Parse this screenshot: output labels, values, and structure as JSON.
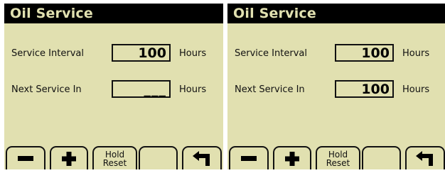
{
  "screens": [
    {
      "title": "Oil Service",
      "service_interval": {
        "label": "Service Interval",
        "value": "100",
        "unit": "Hours"
      },
      "next_service": {
        "label": "Next Service In",
        "value": "___",
        "unit": "Hours"
      },
      "softkeys": {
        "hold_reset": "Hold\nReset"
      }
    },
    {
      "title": "Oil Service",
      "service_interval": {
        "label": "Service Interval",
        "value": "100",
        "unit": "Hours"
      },
      "next_service": {
        "label": "Next Service In",
        "value": "100",
        "unit": "Hours"
      },
      "softkeys": {
        "hold_reset": "Hold\nReset"
      }
    }
  ],
  "icons": [
    "minus-icon",
    "plus-icon",
    "back-arrow-icon"
  ],
  "colors": {
    "background": "#e1e0b0",
    "titlebar": "#000000",
    "text": "#111111"
  }
}
